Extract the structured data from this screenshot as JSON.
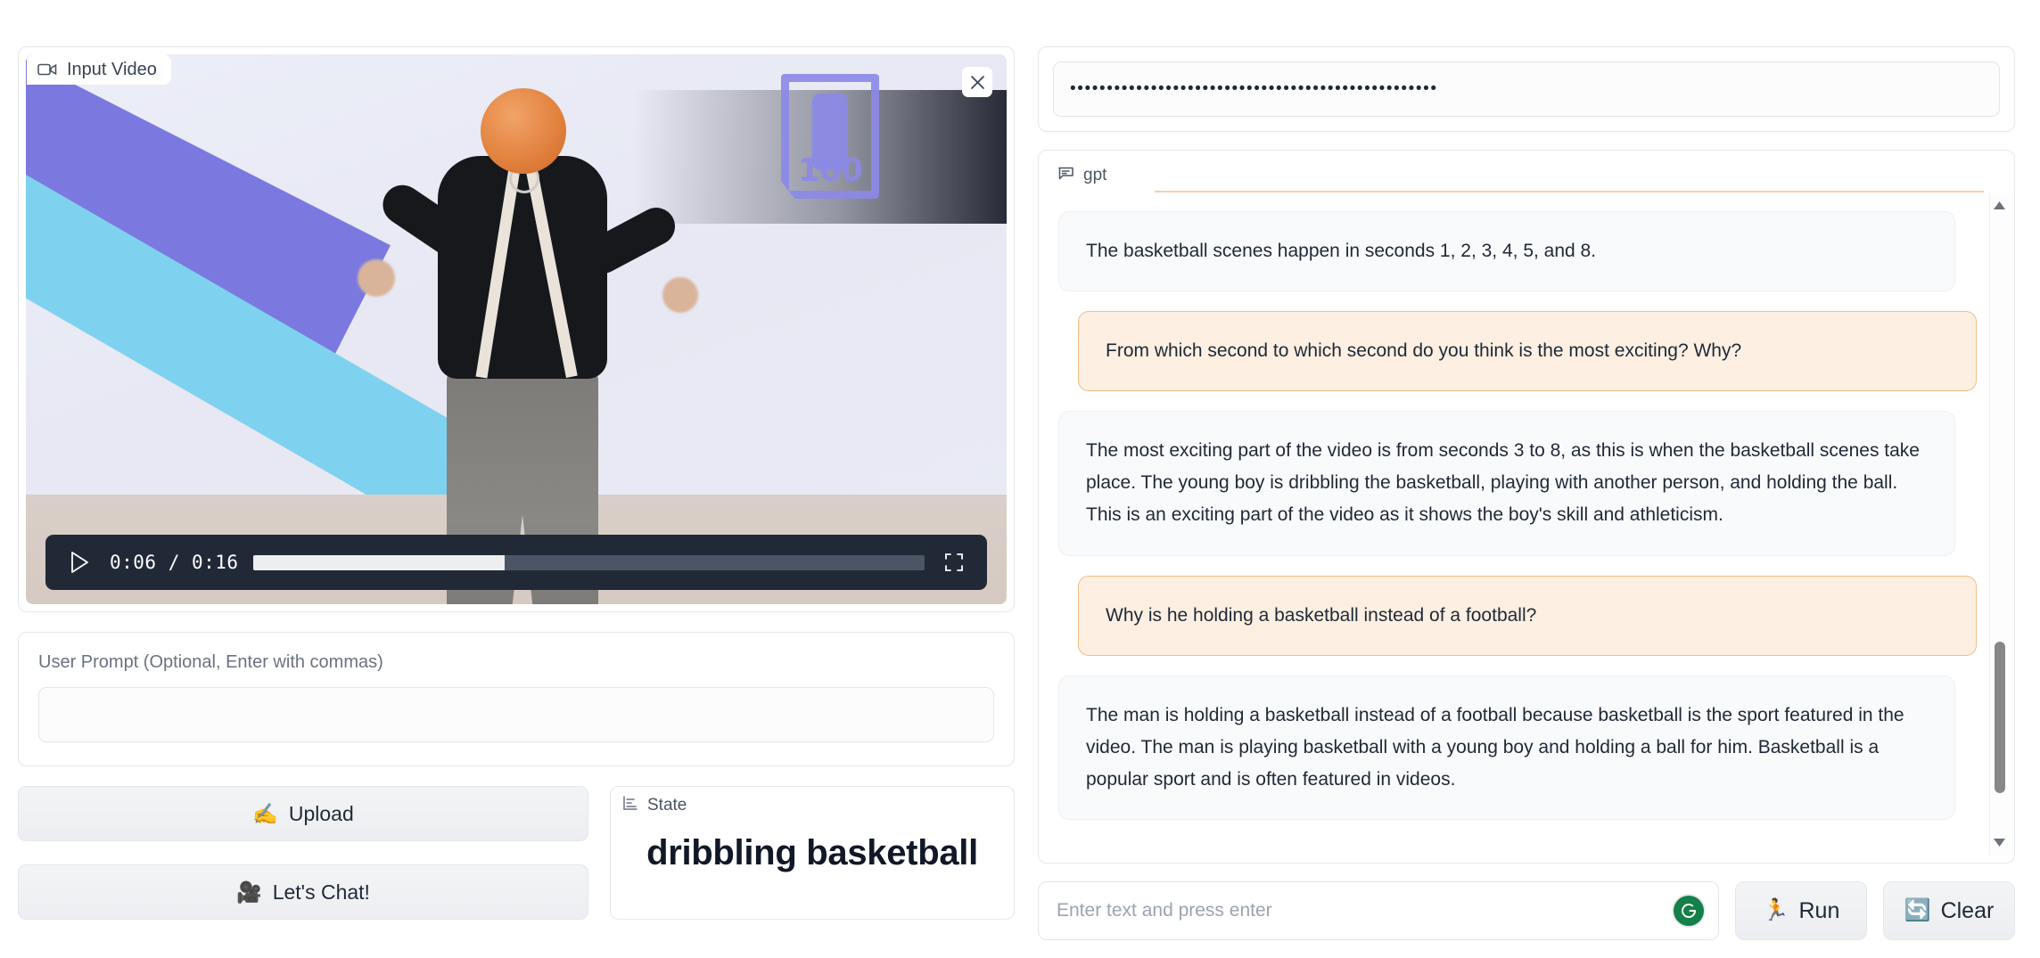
{
  "video_panel": {
    "tab_label": "Input Video",
    "tab_icon": "video-camera-icon",
    "close_icon": "close-icon",
    "overlay_text": "100",
    "controls": {
      "play_icon": "play-icon",
      "current_time": "0:06",
      "separator": "/",
      "total_time": "0:16",
      "time_display": "0:06 / 0:16",
      "progress_percent": 37.5,
      "fullscreen_icon": "fullscreen-icon"
    }
  },
  "prompt_panel": {
    "label": "User Prompt (Optional, Enter with commas)",
    "value": "",
    "placeholder": ""
  },
  "buttons": {
    "upload": {
      "label": "Upload",
      "emoji": "✍️"
    },
    "lets_chat": {
      "label": "Let's Chat!",
      "emoji": "🎥"
    }
  },
  "state_panel": {
    "tab_label": "State",
    "tab_icon": "chart-icon",
    "value": "dribbling basketball"
  },
  "api_key": {
    "value": "••••••••••••••••••••••••••••••••••••••••••••••••••",
    "placeholder": ""
  },
  "chat": {
    "tab_label": "gpt",
    "tab_icon": "chat-bubble-icon",
    "messages": [
      {
        "role": "bot",
        "text": "The basketball scenes happen in seconds 1, 2, 3, 4, 5, and 8."
      },
      {
        "role": "user",
        "text": "From which second to which second do you think is the most exciting? Why?"
      },
      {
        "role": "bot",
        "text": "The most exciting part of the video is from seconds 3 to 8, as this is when the basketball scenes take place. The young boy is dribbling the basketball, playing with another person, and holding the ball. This is an exciting part of the video as it shows the boy's skill and athleticism."
      },
      {
        "role": "user",
        "text": "Why is he holding a basketball instead of a football?"
      },
      {
        "role": "bot",
        "text": "The man is holding a basketball instead of a football because basketball is the sport featured in the video. The man is playing basketball with a young boy and holding a ball for him. Basketball is a popular sport and is often featured in videos."
      }
    ],
    "input_placeholder": "Enter text and press enter",
    "input_value": "",
    "grammarly_icon": "grammarly-icon",
    "run_button": {
      "label": "Run",
      "emoji": "🏃"
    },
    "clear_button": {
      "label": "Clear",
      "emoji": "🔄"
    }
  },
  "colors": {
    "user_bubble_bg": "#fdf0e2",
    "user_bubble_border": "#f3bd85",
    "bot_bubble_bg": "#f9fafb",
    "accent_orange": "#f0a868",
    "control_bar": "#212936",
    "grammarly_green": "#15804a"
  }
}
